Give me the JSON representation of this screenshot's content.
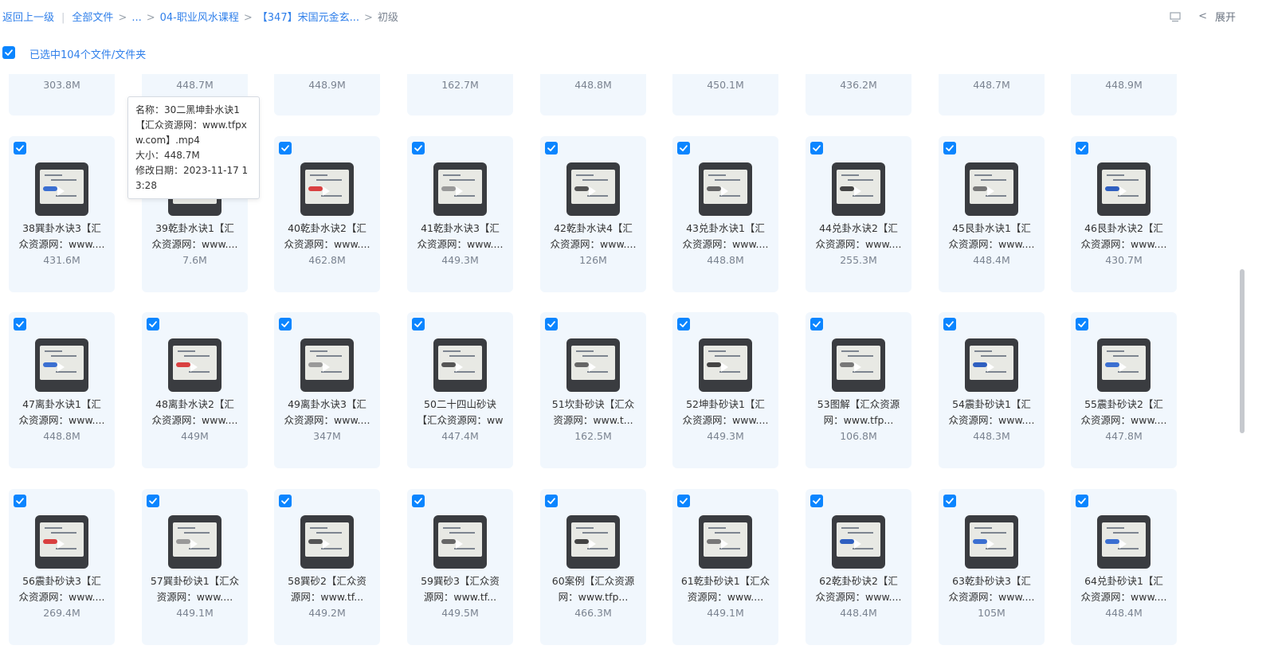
{
  "breadcrumb": {
    "back": "返回上一级",
    "all_files": "全部文件",
    "ellipsis": "...",
    "folder1": "04-职业风水课程",
    "folder2": "【347】宋国元金玄...",
    "current": "初级",
    "sep": ">"
  },
  "topright": {
    "expand": "展开",
    "chevron": "<",
    "icon": "list-view-icon"
  },
  "selection": {
    "text": "已选中104个文件/文件夹",
    "checked": true
  },
  "top_row_sizes": [
    "303.8M",
    "448.7M",
    "448.9M",
    "162.7M",
    "448.8M",
    "450.1M",
    "436.2M",
    "448.7M",
    "448.9M"
  ],
  "rows": [
    [
      {
        "l1": "38巽卦水诀3【汇",
        "l2": "众资源网：www....",
        "size": "431.6M"
      },
      {
        "l1": "39乾卦水诀1【汇",
        "l2": "众资源网：www....",
        "size": "7.6M"
      },
      {
        "l1": "40乾卦水诀2【汇",
        "l2": "众资源网：www....",
        "size": "462.8M"
      },
      {
        "l1": "41乾卦水诀3【汇",
        "l2": "众资源网：www....",
        "size": "449.3M"
      },
      {
        "l1": "42乾卦水诀4【汇",
        "l2": "众资源网：www....",
        "size": "126M"
      },
      {
        "l1": "43兑卦水诀1【汇",
        "l2": "众资源网：www....",
        "size": "448.8M"
      },
      {
        "l1": "44兑卦水诀2【汇",
        "l2": "众资源网：www....",
        "size": "255.3M"
      },
      {
        "l1": "45艮卦水诀1【汇",
        "l2": "众资源网：www....",
        "size": "448.4M"
      },
      {
        "l1": "46艮卦水诀2【汇",
        "l2": "众资源网：www....",
        "size": "430.7M"
      }
    ],
    [
      {
        "l1": "47离卦水诀1【汇",
        "l2": "众资源网：www....",
        "size": "448.8M"
      },
      {
        "l1": "48离卦水诀2【汇",
        "l2": "众资源网：www....",
        "size": "449M"
      },
      {
        "l1": "49离卦水诀3【汇",
        "l2": "众资源网：www....",
        "size": "347M"
      },
      {
        "l1": "50二十四山砂诀",
        "l2": "【汇众资源网：ww",
        "size": "447.4M"
      },
      {
        "l1": "51坎卦砂诀【汇众",
        "l2": "资源网：www.t...",
        "size": "162.5M"
      },
      {
        "l1": "52坤卦砂诀1【汇",
        "l2": "众资源网：www....",
        "size": "449.3M"
      },
      {
        "l1": "53图解【汇众资源",
        "l2": "网：www.tfp...",
        "size": "106.8M"
      },
      {
        "l1": "54震卦砂诀1【汇",
        "l2": "众资源网：www....",
        "size": "448.3M"
      },
      {
        "l1": "55震卦砂诀2【汇",
        "l2": "众资源网：www....",
        "size": "447.8M"
      }
    ],
    [
      {
        "l1": "56震卦砂诀3【汇",
        "l2": "众资源网：www....",
        "size": "269.4M"
      },
      {
        "l1": "57巽卦砂诀1【汇众",
        "l2": "资源网：www....",
        "size": "449.1M"
      },
      {
        "l1": "58巽砂2【汇众资",
        "l2": "源网：www.tf...",
        "size": "449.2M"
      },
      {
        "l1": "59巽砂3【汇众资",
        "l2": "源网：www.tf...",
        "size": "449.5M"
      },
      {
        "l1": "60案例【汇众资源",
        "l2": "网：www.tfp...",
        "size": "466.3M"
      },
      {
        "l1": "61乾卦砂诀1【汇众",
        "l2": "资源网：www....",
        "size": "449.1M"
      },
      {
        "l1": "62乾卦砂诀2【汇",
        "l2": "众资源网：www....",
        "size": "448.4M"
      },
      {
        "l1": "63乾卦砂诀3【汇",
        "l2": "众资源网：www....",
        "size": "105M"
      },
      {
        "l1": "64兑卦砂诀1【汇",
        "l2": "众资源网：www....",
        "size": "448.4M"
      }
    ]
  ],
  "tooltip": {
    "name": "名称：30二黑坤卦水诀1【汇众资源网：www.tfpxw.com】.mp4",
    "size": "大小：448.7M",
    "date": "修改日期：2023-11-17 13:28"
  },
  "colors": {
    "accent": "#0b85ff",
    "card_bg": "#f1f7fd",
    "link": "#2f7fea"
  }
}
